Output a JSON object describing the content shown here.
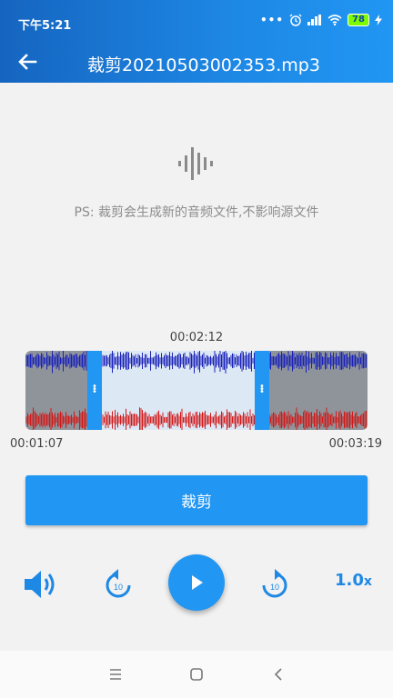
{
  "status_bar": {
    "time": "下午5:21",
    "dots": "•••",
    "battery": "78"
  },
  "app_bar": {
    "title": "裁剪20210503002353.mp3",
    "back_icon": "arrow-left-icon"
  },
  "content": {
    "hint": "PS: 裁剪会生成新的音频文件,不影响源文件",
    "voice_icon": "audio-waveform-icon"
  },
  "waveform": {
    "selected_duration": "00:02:12",
    "start_time": "00:01:07",
    "end_time": "00:03:19",
    "colors": {
      "upper_channel": "#1a22b8",
      "lower_channel": "#d11a1a",
      "selected_bg": "#dde8f5",
      "unselected_bg": "#8f949b",
      "handle": "#2196f3"
    }
  },
  "actions": {
    "cut_label": "裁剪"
  },
  "player": {
    "speed": "1.0",
    "speed_suffix": "x",
    "rewind_label": "10",
    "forward_label": "10",
    "accent": "#2196f3"
  },
  "nav": {
    "recents_icon": "menu-icon",
    "home_icon": "square-icon",
    "back_icon": "chevron-left-icon"
  }
}
